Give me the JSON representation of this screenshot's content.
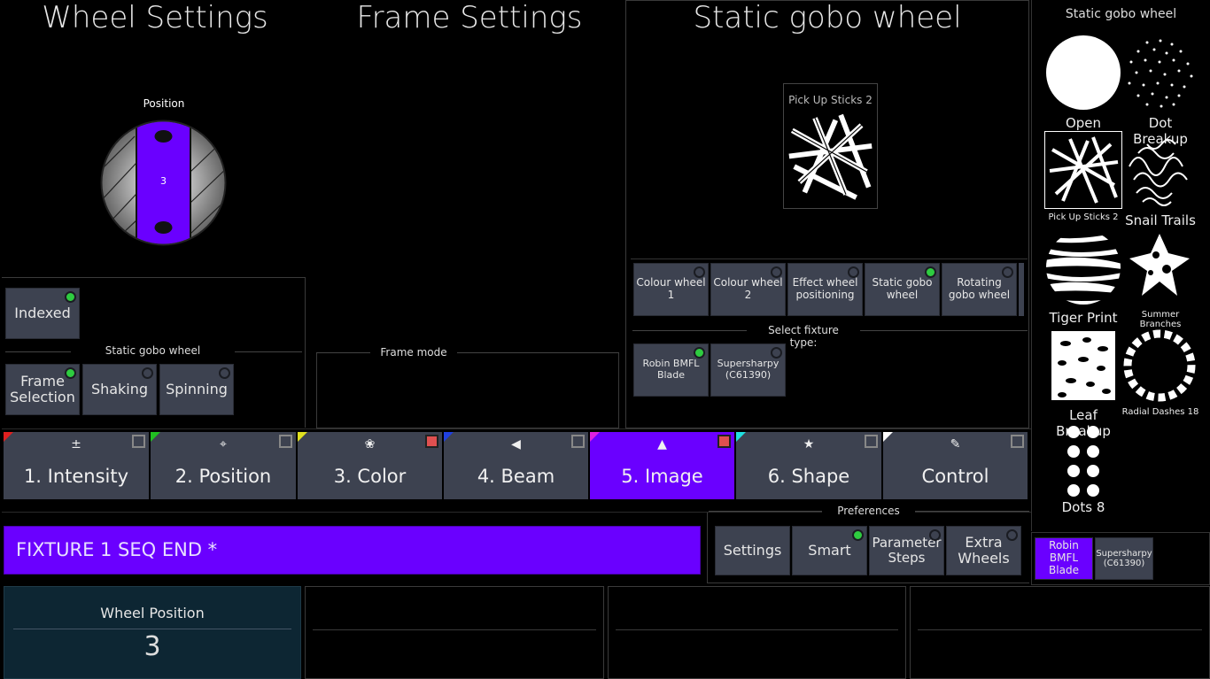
{
  "headers": {
    "wheel_settings": "Wheel Settings",
    "frame_settings": "Frame Settings",
    "static_gobo": "Static gobo wheel"
  },
  "wheel": {
    "position_label": "Position",
    "slot": "3"
  },
  "mode_buttons": {
    "indexed": "Indexed",
    "section_label": "Static gobo wheel",
    "frame_selection": "Frame Selection",
    "shaking": "Shaking",
    "spinning": "Spinning"
  },
  "frame_mode_label": "Frame mode",
  "preview": {
    "name": "Pick Up Sticks 2"
  },
  "wheel_selector": [
    {
      "label": "Colour wheel 1",
      "active": false
    },
    {
      "label": "Colour wheel 2",
      "active": false
    },
    {
      "label": "Effect wheel positioning",
      "active": false
    },
    {
      "label": "Static gobo wheel",
      "active": true
    },
    {
      "label": "Rotating gobo wheel",
      "active": false
    }
  ],
  "fixture_type": {
    "label": "Select fixture type:",
    "items": [
      {
        "label": "Robin BMFL Blade",
        "active": true
      },
      {
        "label": "Supersharpy (C61390)",
        "active": false
      }
    ]
  },
  "tabs": [
    {
      "label": "1. Intensity",
      "icon": "±",
      "corner": "#e02020",
      "selected": false,
      "marker": "grey"
    },
    {
      "label": "2. Position",
      "icon": "⌖",
      "corner": "#20c020",
      "selected": false,
      "marker": "grey"
    },
    {
      "label": "3. Color",
      "icon": "❀",
      "corner": "#e0e020",
      "selected": false,
      "marker": "red"
    },
    {
      "label": "4. Beam",
      "icon": "◀",
      "corner": "#2040e0",
      "selected": false,
      "marker": "grey"
    },
    {
      "label": "5. Image",
      "icon": "▲",
      "corner": "#e020e0",
      "selected": true,
      "marker": "red"
    },
    {
      "label": "6. Shape",
      "icon": "★",
      "corner": "#20e0e0",
      "selected": false,
      "marker": "grey"
    },
    {
      "label": "Control",
      "icon": "✎",
      "corner": "#ffffff",
      "selected": false,
      "marker": "grey"
    }
  ],
  "cue_bar": "FIXTURE 1 SEQ END *",
  "preferences": {
    "label": "Preferences",
    "buttons": [
      {
        "label": "Settings",
        "active": false,
        "dot": false
      },
      {
        "label": "Smart",
        "active": true,
        "dot": true
      },
      {
        "label": "Parameter Steps",
        "active": false,
        "dot": true
      },
      {
        "label": "Extra Wheels",
        "active": false,
        "dot": true
      }
    ]
  },
  "sidebar": {
    "title": "Static gobo wheel",
    "gobos": [
      {
        "label": "Open"
      },
      {
        "label": "Dot Breakup"
      },
      {
        "label": "Pick Up Sticks 2",
        "small": true
      },
      {
        "label": "Snail Trails"
      },
      {
        "label": "Tiger Print"
      },
      {
        "label": "Summer Branches",
        "small": true
      },
      {
        "label": "Leaf Breakup"
      },
      {
        "label": "Radial Dashes 18",
        "small": true
      },
      {
        "label": "Dots 8"
      }
    ],
    "fixtures": [
      "Robin BMFL Blade",
      "Supersharpy (C61390)"
    ]
  },
  "encoder": {
    "label": "Wheel Position",
    "value": "3"
  },
  "colors": {
    "accent": "#6a00ff",
    "panel": "#3d4250",
    "encoder_bg": "#0d2633"
  }
}
